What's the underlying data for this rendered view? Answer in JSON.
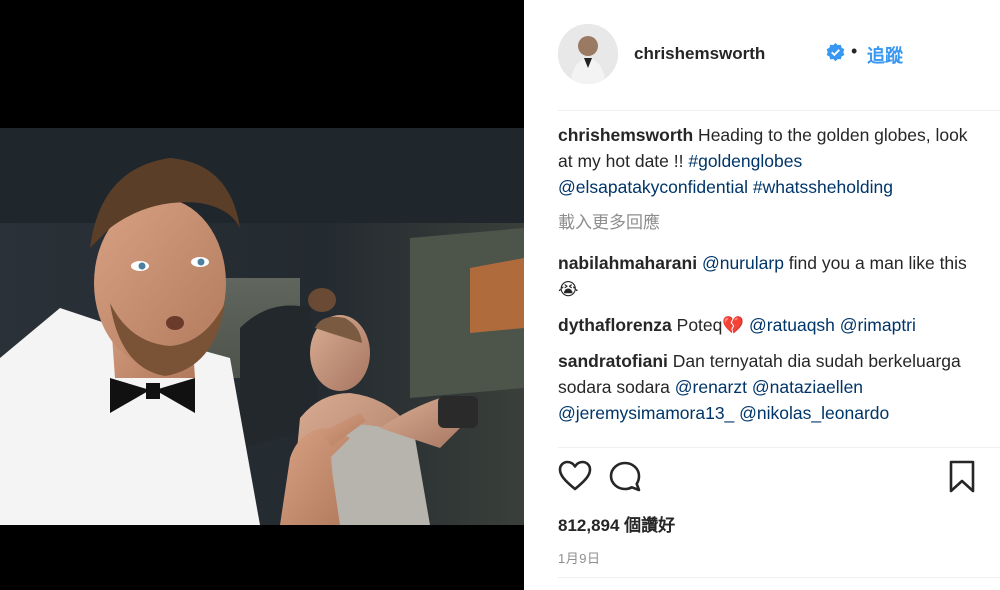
{
  "post": {
    "username": "chrishemsworth",
    "follow_label": "追蹤",
    "separator": "•",
    "caption": {
      "text_before": " Heading to the golden globes, look at my hot date !! ",
      "hashtag1": "#goldenglobes",
      "mention1": "@elsapatakyconfidential",
      "hashtag2": "#whatssheholding"
    },
    "load_more_label": "載入更多回應",
    "comments": [
      {
        "user": "nabilahmaharani",
        "parts": [
          {
            "type": "mention",
            "text": "@nurularp"
          },
          {
            "type": "text",
            "text": " find you a man like this 😭"
          }
        ]
      },
      {
        "user": "dythaflorenza",
        "parts": [
          {
            "type": "text",
            "text": "Poteq💔 "
          },
          {
            "type": "mention",
            "text": "@ratuaqsh"
          },
          {
            "type": "text",
            "text": " "
          },
          {
            "type": "mention",
            "text": "@rimaptri"
          }
        ]
      },
      {
        "user": "sandratofiani",
        "parts": [
          {
            "type": "text",
            "text": "Dan ternyatah dia sudah berkeluarga sodara sodara "
          },
          {
            "type": "mention",
            "text": "@renarzt"
          },
          {
            "type": "text",
            "text": " "
          },
          {
            "type": "mention",
            "text": "@nataziaellen"
          },
          {
            "type": "text",
            "text": " "
          },
          {
            "type": "mention",
            "text": "@jeremysimamora13_"
          },
          {
            "type": "text",
            "text": " "
          },
          {
            "type": "mention",
            "text": "@nikolas_leonardo"
          }
        ]
      }
    ],
    "likes": "812,894 個讚好",
    "date": "1月9日"
  },
  "icons": {
    "like": "heart-outline-icon",
    "comment": "speech-bubble-icon",
    "save": "bookmark-icon",
    "verified": "verified-badge-icon"
  },
  "colors": {
    "link": "#003569",
    "follow": "#3897f0",
    "verified": "#3897f0",
    "muted": "#8e8e8e"
  }
}
